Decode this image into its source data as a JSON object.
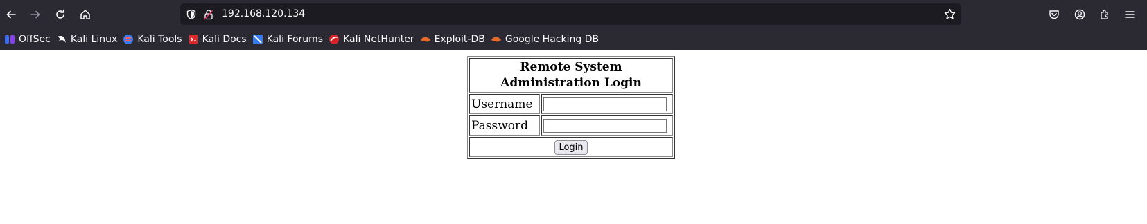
{
  "browser": {
    "url": "192.168.120.134",
    "bookmarks": [
      {
        "label": "OffSec",
        "icon": "offsec-icon"
      },
      {
        "label": "Kali Linux",
        "icon": "kali-dragon-icon"
      },
      {
        "label": "Kali Tools",
        "icon": "kali-tools-icon"
      },
      {
        "label": "Kali Docs",
        "icon": "kali-docs-icon"
      },
      {
        "label": "Kali Forums",
        "icon": "kali-forums-icon"
      },
      {
        "label": "Kali NetHunter",
        "icon": "kali-nethunter-icon"
      },
      {
        "label": "Exploit-DB",
        "icon": "exploit-db-icon"
      },
      {
        "label": "Google Hacking DB",
        "icon": "ghdb-icon"
      }
    ]
  },
  "page": {
    "title": "Remote System Administration Login",
    "username_label": "Username",
    "password_label": "Password",
    "username_value": "",
    "password_value": "",
    "login_button": "Login"
  }
}
